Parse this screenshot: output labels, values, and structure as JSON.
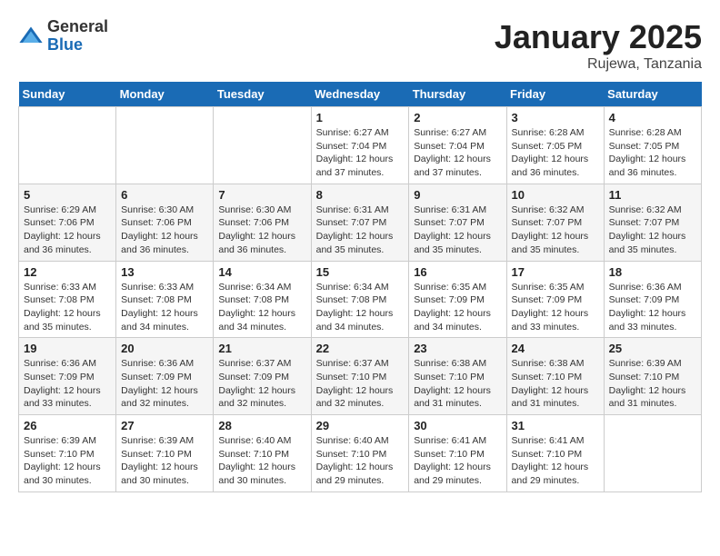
{
  "logo": {
    "general": "General",
    "blue": "Blue"
  },
  "title": "January 2025",
  "location": "Rujewa, Tanzania",
  "days_of_week": [
    "Sunday",
    "Monday",
    "Tuesday",
    "Wednesday",
    "Thursday",
    "Friday",
    "Saturday"
  ],
  "weeks": [
    [
      {
        "day": "",
        "info": ""
      },
      {
        "day": "",
        "info": ""
      },
      {
        "day": "",
        "info": ""
      },
      {
        "day": "1",
        "info": "Sunrise: 6:27 AM\nSunset: 7:04 PM\nDaylight: 12 hours and 37 minutes."
      },
      {
        "day": "2",
        "info": "Sunrise: 6:27 AM\nSunset: 7:04 PM\nDaylight: 12 hours and 37 minutes."
      },
      {
        "day": "3",
        "info": "Sunrise: 6:28 AM\nSunset: 7:05 PM\nDaylight: 12 hours and 36 minutes."
      },
      {
        "day": "4",
        "info": "Sunrise: 6:28 AM\nSunset: 7:05 PM\nDaylight: 12 hours and 36 minutes."
      }
    ],
    [
      {
        "day": "5",
        "info": "Sunrise: 6:29 AM\nSunset: 7:06 PM\nDaylight: 12 hours and 36 minutes."
      },
      {
        "day": "6",
        "info": "Sunrise: 6:30 AM\nSunset: 7:06 PM\nDaylight: 12 hours and 36 minutes."
      },
      {
        "day": "7",
        "info": "Sunrise: 6:30 AM\nSunset: 7:06 PM\nDaylight: 12 hours and 36 minutes."
      },
      {
        "day": "8",
        "info": "Sunrise: 6:31 AM\nSunset: 7:07 PM\nDaylight: 12 hours and 35 minutes."
      },
      {
        "day": "9",
        "info": "Sunrise: 6:31 AM\nSunset: 7:07 PM\nDaylight: 12 hours and 35 minutes."
      },
      {
        "day": "10",
        "info": "Sunrise: 6:32 AM\nSunset: 7:07 PM\nDaylight: 12 hours and 35 minutes."
      },
      {
        "day": "11",
        "info": "Sunrise: 6:32 AM\nSunset: 7:07 PM\nDaylight: 12 hours and 35 minutes."
      }
    ],
    [
      {
        "day": "12",
        "info": "Sunrise: 6:33 AM\nSunset: 7:08 PM\nDaylight: 12 hours and 35 minutes."
      },
      {
        "day": "13",
        "info": "Sunrise: 6:33 AM\nSunset: 7:08 PM\nDaylight: 12 hours and 34 minutes."
      },
      {
        "day": "14",
        "info": "Sunrise: 6:34 AM\nSunset: 7:08 PM\nDaylight: 12 hours and 34 minutes."
      },
      {
        "day": "15",
        "info": "Sunrise: 6:34 AM\nSunset: 7:08 PM\nDaylight: 12 hours and 34 minutes."
      },
      {
        "day": "16",
        "info": "Sunrise: 6:35 AM\nSunset: 7:09 PM\nDaylight: 12 hours and 34 minutes."
      },
      {
        "day": "17",
        "info": "Sunrise: 6:35 AM\nSunset: 7:09 PM\nDaylight: 12 hours and 33 minutes."
      },
      {
        "day": "18",
        "info": "Sunrise: 6:36 AM\nSunset: 7:09 PM\nDaylight: 12 hours and 33 minutes."
      }
    ],
    [
      {
        "day": "19",
        "info": "Sunrise: 6:36 AM\nSunset: 7:09 PM\nDaylight: 12 hours and 33 minutes."
      },
      {
        "day": "20",
        "info": "Sunrise: 6:36 AM\nSunset: 7:09 PM\nDaylight: 12 hours and 32 minutes."
      },
      {
        "day": "21",
        "info": "Sunrise: 6:37 AM\nSunset: 7:09 PM\nDaylight: 12 hours and 32 minutes."
      },
      {
        "day": "22",
        "info": "Sunrise: 6:37 AM\nSunset: 7:10 PM\nDaylight: 12 hours and 32 minutes."
      },
      {
        "day": "23",
        "info": "Sunrise: 6:38 AM\nSunset: 7:10 PM\nDaylight: 12 hours and 31 minutes."
      },
      {
        "day": "24",
        "info": "Sunrise: 6:38 AM\nSunset: 7:10 PM\nDaylight: 12 hours and 31 minutes."
      },
      {
        "day": "25",
        "info": "Sunrise: 6:39 AM\nSunset: 7:10 PM\nDaylight: 12 hours and 31 minutes."
      }
    ],
    [
      {
        "day": "26",
        "info": "Sunrise: 6:39 AM\nSunset: 7:10 PM\nDaylight: 12 hours and 30 minutes."
      },
      {
        "day": "27",
        "info": "Sunrise: 6:39 AM\nSunset: 7:10 PM\nDaylight: 12 hours and 30 minutes."
      },
      {
        "day": "28",
        "info": "Sunrise: 6:40 AM\nSunset: 7:10 PM\nDaylight: 12 hours and 30 minutes."
      },
      {
        "day": "29",
        "info": "Sunrise: 6:40 AM\nSunset: 7:10 PM\nDaylight: 12 hours and 29 minutes."
      },
      {
        "day": "30",
        "info": "Sunrise: 6:41 AM\nSunset: 7:10 PM\nDaylight: 12 hours and 29 minutes."
      },
      {
        "day": "31",
        "info": "Sunrise: 6:41 AM\nSunset: 7:10 PM\nDaylight: 12 hours and 29 minutes."
      },
      {
        "day": "",
        "info": ""
      }
    ]
  ]
}
